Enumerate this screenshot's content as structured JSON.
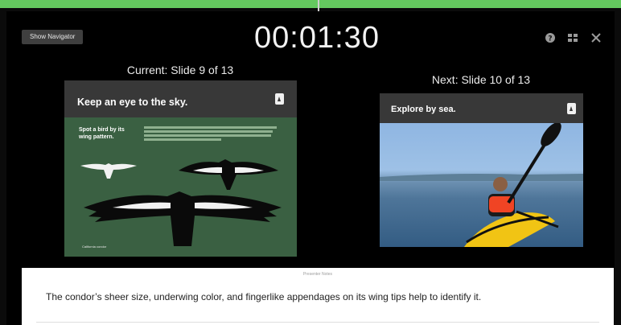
{
  "toolbar": {
    "show_navigator_label": "Show Navigator",
    "timer": "00:01:30",
    "icons": [
      "help-icon",
      "slide-layout-icon",
      "close-icon"
    ]
  },
  "current_slide": {
    "label": "Current: Slide 9 of 13",
    "title": "Keep an eye to the sky.",
    "subheading": "Spot a bird by its wing pattern.",
    "caption": "California condor"
  },
  "next_slide": {
    "label": "Next: Slide 10 of 13",
    "title": "Explore by sea."
  },
  "presenter_notes": {
    "title": "Presenter Notes",
    "text": "The condor’s sheer size, underwing color, and fingerlike appendages on its wing tips help to identify it."
  },
  "colors": {
    "top_bar": "#64c95f",
    "current_slide_bg": "#3a6042",
    "title_bar": "#383838"
  }
}
